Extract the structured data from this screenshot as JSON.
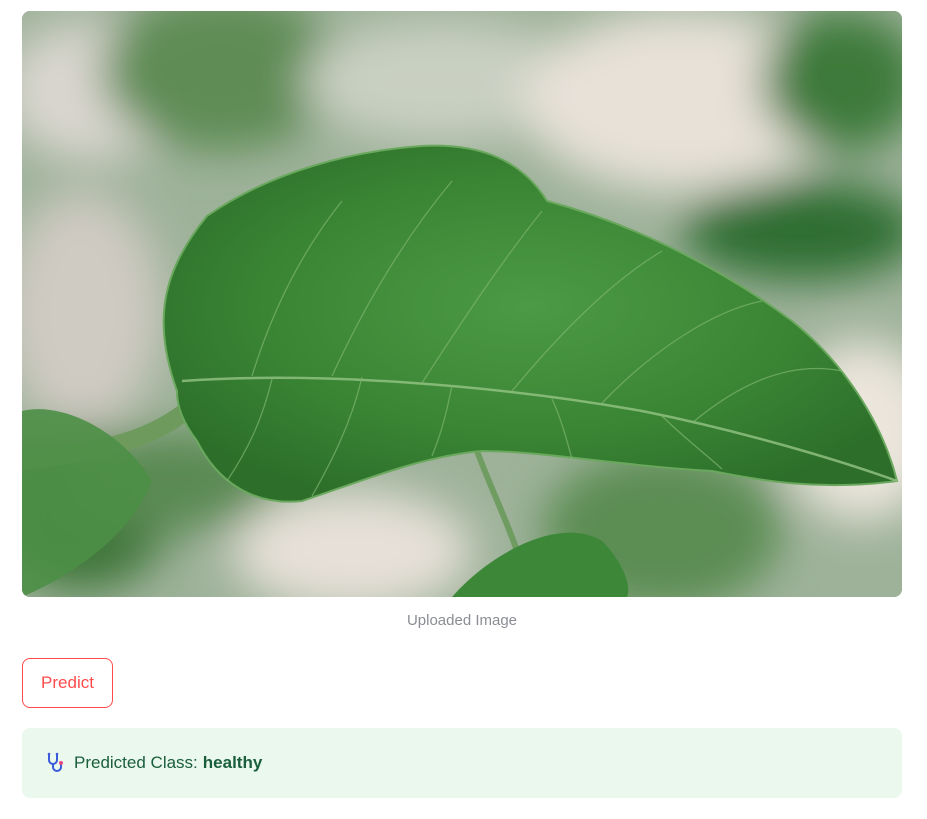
{
  "image": {
    "caption": "Uploaded Image",
    "icon": "leaf-photo"
  },
  "predict_button": {
    "label": "Predict"
  },
  "result": {
    "icon": "stethoscope-icon",
    "label": "Predicted Class:",
    "value": "healthy"
  },
  "colors": {
    "accent": "#ff4b4b",
    "success_bg": "#eaf8ed",
    "success_text": "#1b5e3b",
    "caption_text": "#8a8d93"
  }
}
